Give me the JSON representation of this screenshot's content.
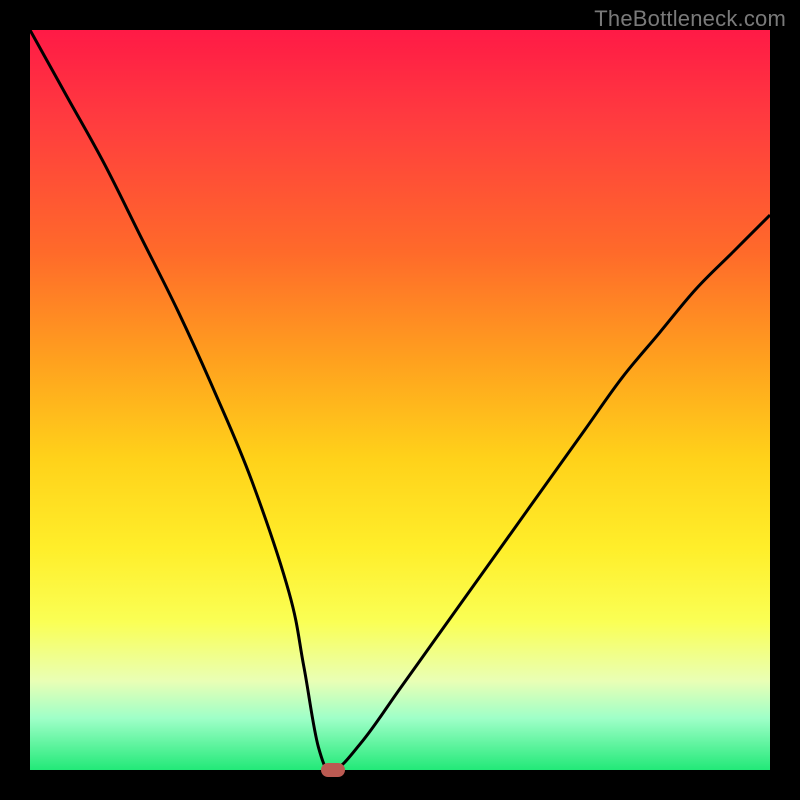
{
  "watermark": "TheBottleneck.com",
  "chart_data": {
    "type": "line",
    "title": "",
    "xlabel": "",
    "ylabel": "",
    "xlim": [
      0,
      100
    ],
    "ylim": [
      0,
      100
    ],
    "grid": false,
    "legend": false,
    "series": [
      {
        "name": "bottleneck_curve",
        "x": [
          0,
          5,
          10,
          15,
          20,
          25,
          30,
          35,
          37,
          39,
          41,
          45,
          50,
          55,
          60,
          65,
          70,
          75,
          80,
          85,
          90,
          95,
          100
        ],
        "values": [
          100,
          91,
          82,
          72,
          62,
          51,
          39,
          24,
          14,
          3,
          0,
          4,
          11,
          18,
          25,
          32,
          39,
          46,
          53,
          59,
          65,
          70,
          75
        ]
      }
    ],
    "marker": {
      "x": 41,
      "y": 0,
      "color": "#bb5a52"
    },
    "gradient_colors": {
      "top": "#ff1a46",
      "mid_upper": "#ffa21e",
      "mid": "#ffee2a",
      "mid_lower": "#e9ffb5",
      "bottom": "#22e978"
    }
  }
}
